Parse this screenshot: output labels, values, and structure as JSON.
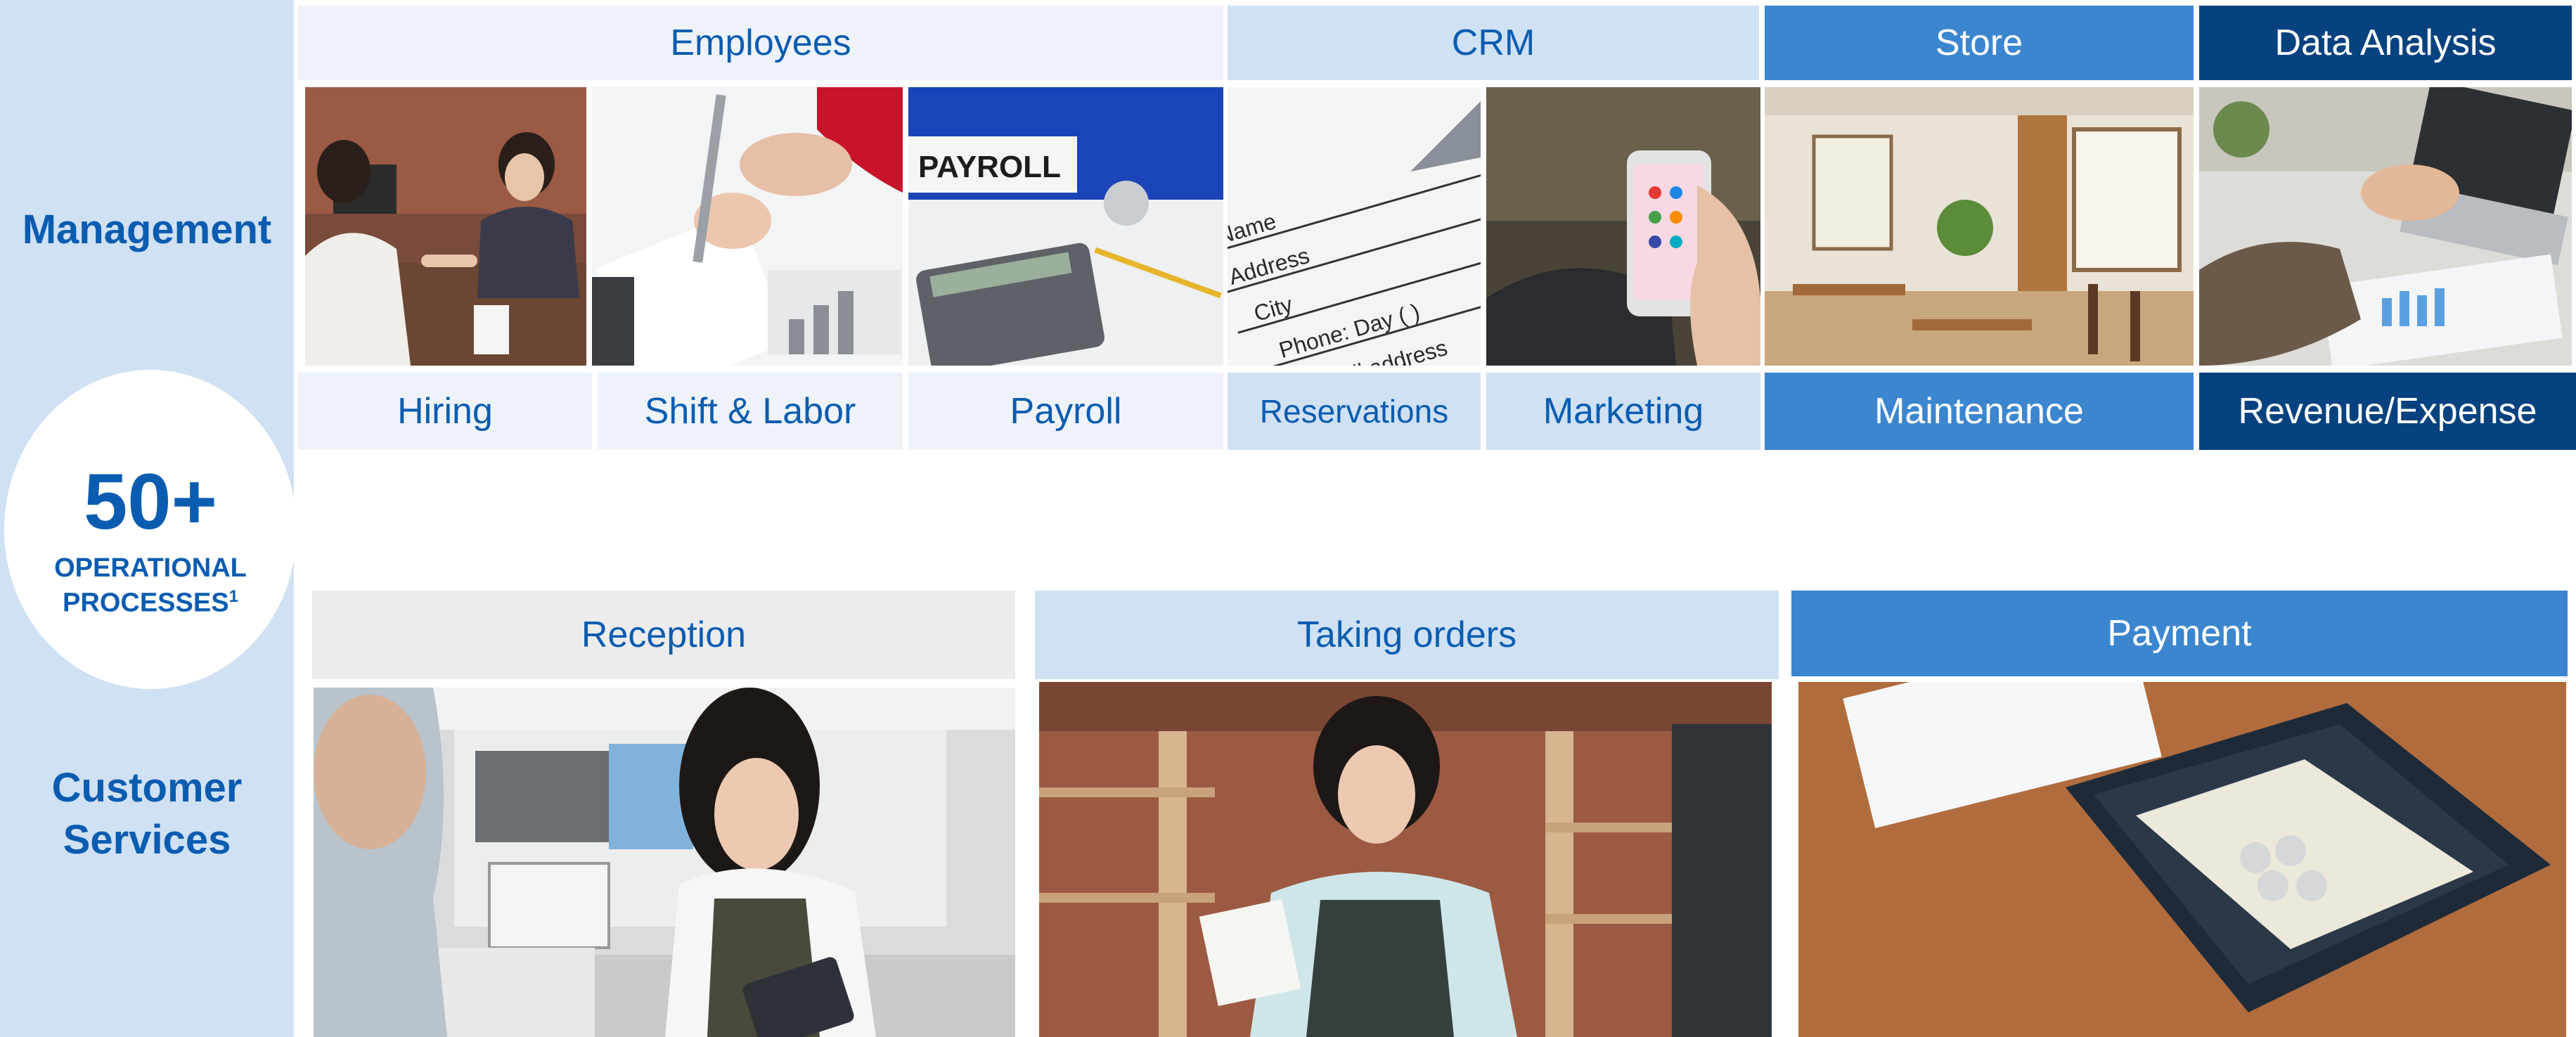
{
  "left": {
    "management_label": "Management",
    "customer_label_line1": "Customer",
    "customer_label_line2": "Services",
    "circle_number": "50+",
    "circle_line1": "OPERATIONAL",
    "circle_line2": "PROCESSES",
    "circle_footnote": "1"
  },
  "management": {
    "headers": [
      "Employees",
      "CRM",
      "Store",
      "Data Analysis"
    ],
    "labels": [
      "Hiring",
      "Shift & Labor",
      "Payroll",
      "Reservations",
      "Marketing",
      "Maintenance",
      "Revenue/Expense"
    ],
    "photo_text": {
      "payroll_binder": "PAYROLL",
      "form_name": "Name",
      "form_address": "Address",
      "form_city": "City",
      "form_phone": "Phone: Day (     )",
      "form_email": "e-mail address"
    }
  },
  "customer_services": {
    "headers": [
      "Reception",
      "Taking orders",
      "Payment"
    ]
  },
  "colors": {
    "pale": "#eef3f9",
    "light": "#cfe1f3",
    "mid": "#3b86cf",
    "dark": "#06427f",
    "text_blue": "#0a5cb0"
  }
}
